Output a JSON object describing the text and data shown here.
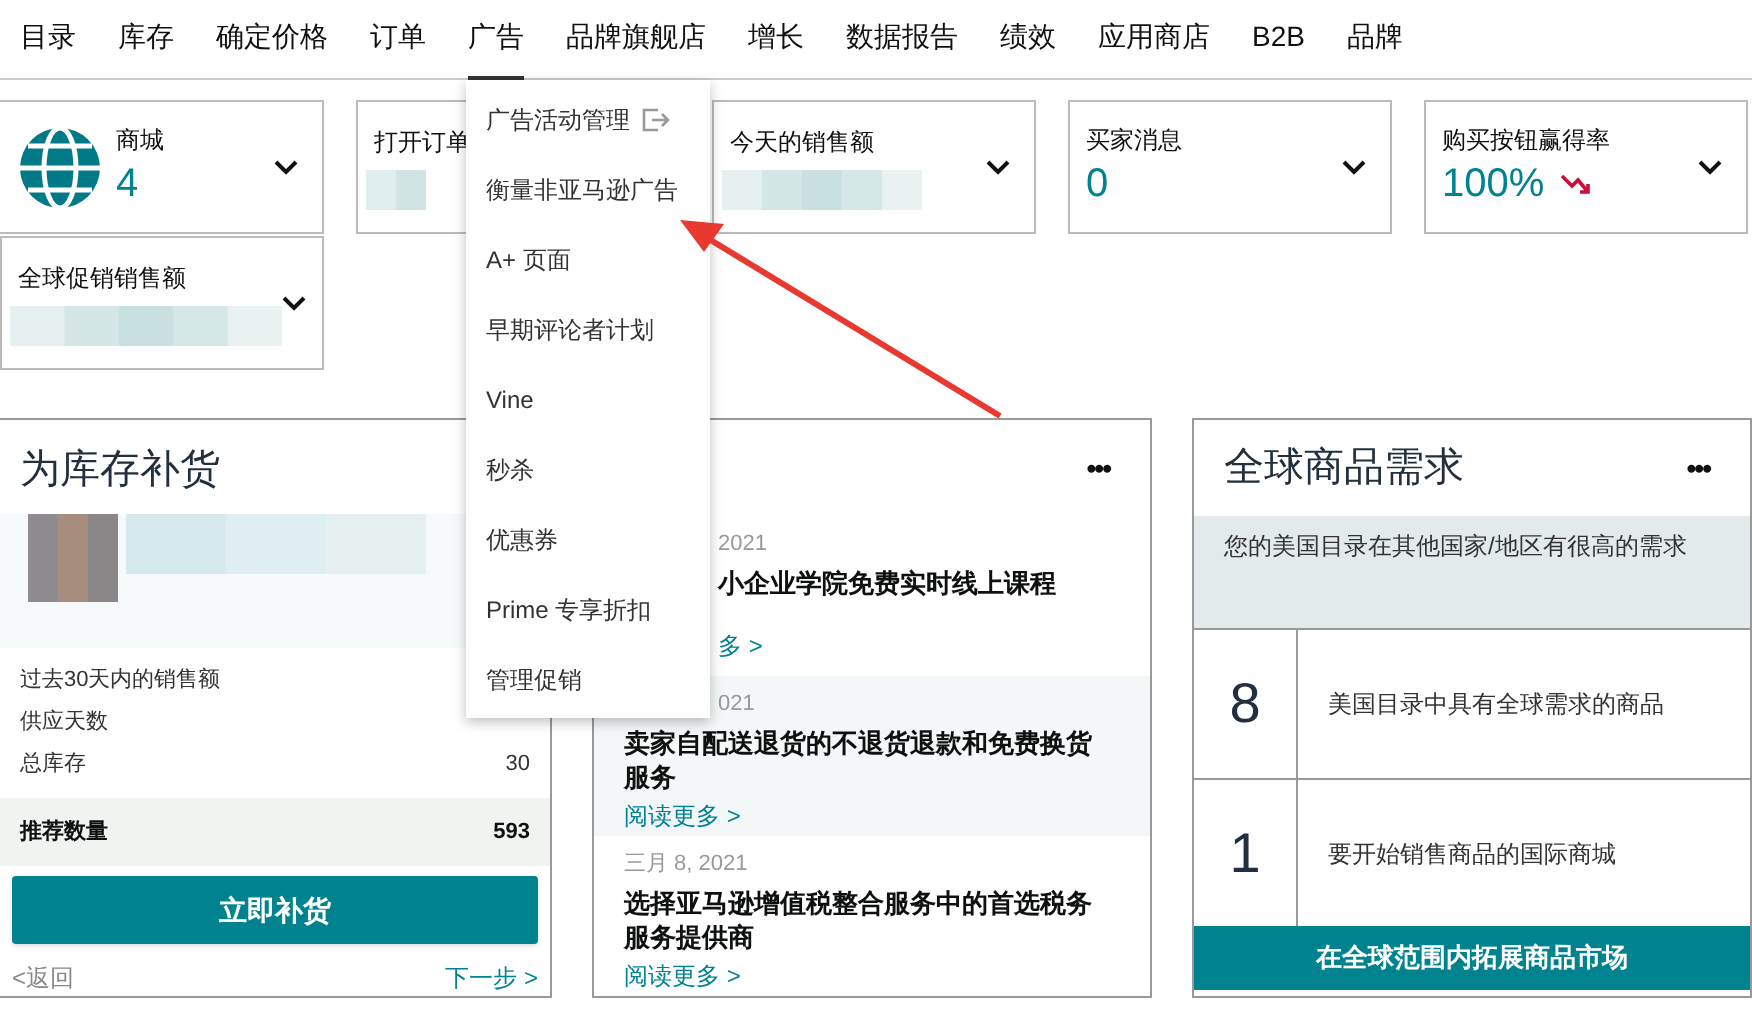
{
  "nav": [
    {
      "label": "目录",
      "selected": false
    },
    {
      "label": "库存",
      "selected": false
    },
    {
      "label": "确定价格",
      "selected": false
    },
    {
      "label": "订单",
      "selected": false
    },
    {
      "label": "广告",
      "selected": true
    },
    {
      "label": "品牌旗舰店",
      "selected": false
    },
    {
      "label": "增长",
      "selected": false
    },
    {
      "label": "数据报告",
      "selected": false
    },
    {
      "label": "绩效",
      "selected": false
    },
    {
      "label": "应用商店",
      "selected": false
    },
    {
      "label": "B2B",
      "selected": false
    },
    {
      "label": "品牌",
      "selected": false
    }
  ],
  "tiles": [
    {
      "kind": "globe",
      "label": "商城",
      "value": "4"
    },
    {
      "kind": "hidden",
      "label": "打开订单"
    },
    {
      "kind": "hidden",
      "label": "今天的销售额"
    },
    {
      "kind": "value",
      "label": "买家消息",
      "value": "0"
    },
    {
      "kind": "trend",
      "label": "购买按钮赢得率",
      "value": "100%"
    },
    {
      "kind": "hidden",
      "label": "全球促销销售额"
    }
  ],
  "menu": [
    {
      "label": "广告活动管理",
      "external": true
    },
    {
      "label": "衡量非亚马逊广告",
      "external": false
    },
    {
      "label": "A+ 页面",
      "external": false
    },
    {
      "label": "早期评论者计划",
      "external": false
    },
    {
      "label": "Vine",
      "external": false
    },
    {
      "label": "秒杀",
      "external": false
    },
    {
      "label": "优惠券",
      "external": false
    },
    {
      "label": "Prime 专享折扣",
      "external": false
    },
    {
      "label": "管理促销",
      "external": false
    }
  ],
  "restock": {
    "title": "为库存补货",
    "stats": [
      {
        "label": "过去30天内的销售额"
      },
      {
        "label": "供应天数"
      },
      {
        "label": "总库存",
        "value": "30"
      }
    ],
    "recommended": {
      "label": "推荐数量",
      "value": "593"
    },
    "button": "立即补货",
    "back": "<返回",
    "next": "下一步 >"
  },
  "news": {
    "more": "•••",
    "items": [
      {
        "date": "2021",
        "title": "小企业学院免费实时线上课程",
        "link": "多 >"
      },
      {
        "date": "021",
        "title": "卖家自配送退货的不退货退款和免费换货服务",
        "link": "阅读更多 >"
      },
      {
        "date": "三月 8, 2021",
        "title": "选择亚马逊增值税整合服务中的首选税务服务提供商",
        "link": "阅读更多 >"
      }
    ]
  },
  "demand": {
    "title": "全球商品需求",
    "more": "•••",
    "notice": "您的美国目录在其他国家/地区有很高的需求",
    "rows": [
      {
        "count": "8",
        "text": "美国目录中具有全球需求的商品"
      },
      {
        "count": "1",
        "text": "要开始销售商品的国际商城"
      }
    ],
    "button": "在全球范围内拓展商品市场"
  }
}
